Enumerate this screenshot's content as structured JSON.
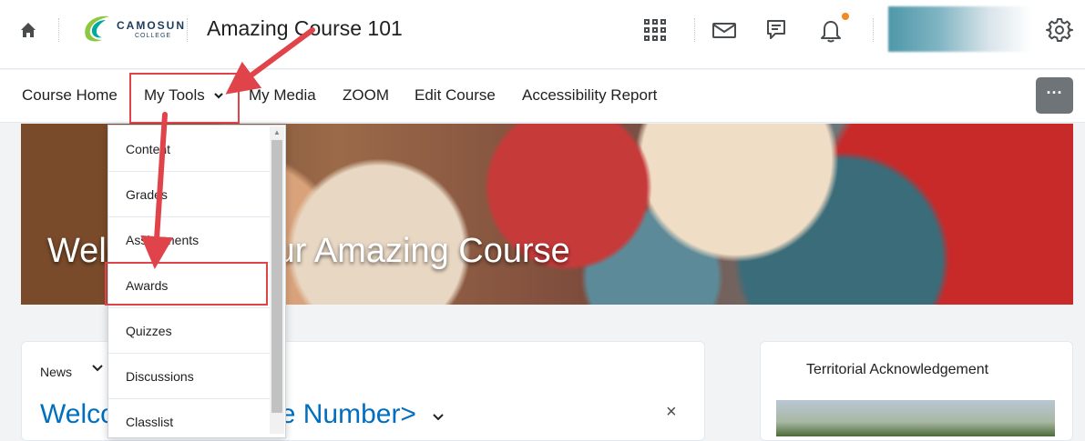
{
  "header": {
    "logo_text": "CAMOSUN",
    "logo_sub": "COLLEGE",
    "course_title": "Amazing Course 101",
    "icons": [
      "home-icon",
      "apps-grid-icon",
      "mail-icon",
      "chat-icon",
      "bell-icon",
      "settings-gear-icon"
    ],
    "notification_color": "#f08a24"
  },
  "nav": {
    "items": [
      "Course Home",
      "My Tools",
      "My Media",
      "ZOOM",
      "Edit Course",
      "Accessibility Report"
    ],
    "more_label": "···"
  },
  "banner": {
    "title": "Welcome to your Amazing Course"
  },
  "dropdown": {
    "items": [
      "Content",
      "Grades",
      "Assignments",
      "Awards",
      "Quizzes",
      "Discussions",
      "Classlist"
    ],
    "highlighted": "Awards"
  },
  "news": {
    "label": "News",
    "heading": "Welcome to <Course Number>",
    "close": "×"
  },
  "sidebar": {
    "title": "Territorial Acknowledgement"
  },
  "colors": {
    "link": "#006fbf",
    "highlight": "#e0444a",
    "accent": "#f08a24"
  }
}
